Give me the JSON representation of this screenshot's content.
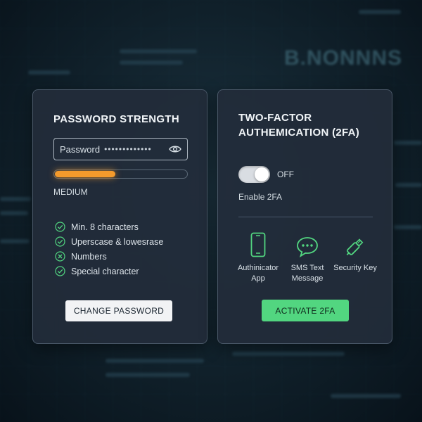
{
  "password_panel": {
    "title": "PASSWORD STRENGTH",
    "field_label": "Password",
    "field_value": "•••••••••••••",
    "strength_fraction": 0.46,
    "strength_color": "#f39a2c",
    "strength_label": "MEDIUM",
    "requirements": [
      {
        "label": "Min. 8 characters",
        "met": true
      },
      {
        "label": "Uperscase & lowesrase",
        "met": true
      },
      {
        "label": "Numbers",
        "met": false
      },
      {
        "label": "Special character",
        "met": true
      }
    ],
    "button_label": "CHANGE PASSWORD"
  },
  "twofa_panel": {
    "title": "TWO-FACTOR AUTHEMICATION (2FA)",
    "toggle_state": "OFF",
    "enable_label": "Enable 2FA",
    "methods": [
      {
        "label": "Authinicator App",
        "icon": "smartphone-icon"
      },
      {
        "label": "SMS Text Message",
        "icon": "chat-bubble-icon"
      },
      {
        "label": "Security Key",
        "icon": "usb-key-icon"
      }
    ],
    "button_label": "ACTIVATE 2FA",
    "accent_color": "#52d680"
  }
}
